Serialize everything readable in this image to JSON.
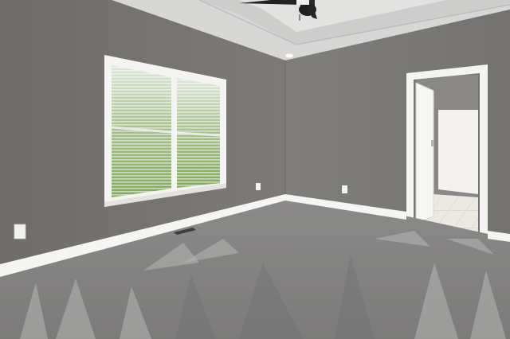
{
  "scene": {
    "kind": "photo-empty-bedroom",
    "elements": [
      "tray-ceiling",
      "ceiling-fan",
      "recessed-light",
      "double-hung-window-with-blinds",
      "open-doorway-to-bathroom",
      "interior-door",
      "baseboard",
      "electrical-outlet",
      "floor-vent",
      "carpet-floor"
    ]
  },
  "colors": {
    "wall_left": "#75726f",
    "wall_right": "#7d7b79",
    "ceiling": "#d9d9d8",
    "trim": "#ffffff",
    "carpet": "#858483",
    "carpet_light": "#b4b3b1",
    "window_view": "#8fb56e",
    "bath_tile": "#e9e6df"
  }
}
